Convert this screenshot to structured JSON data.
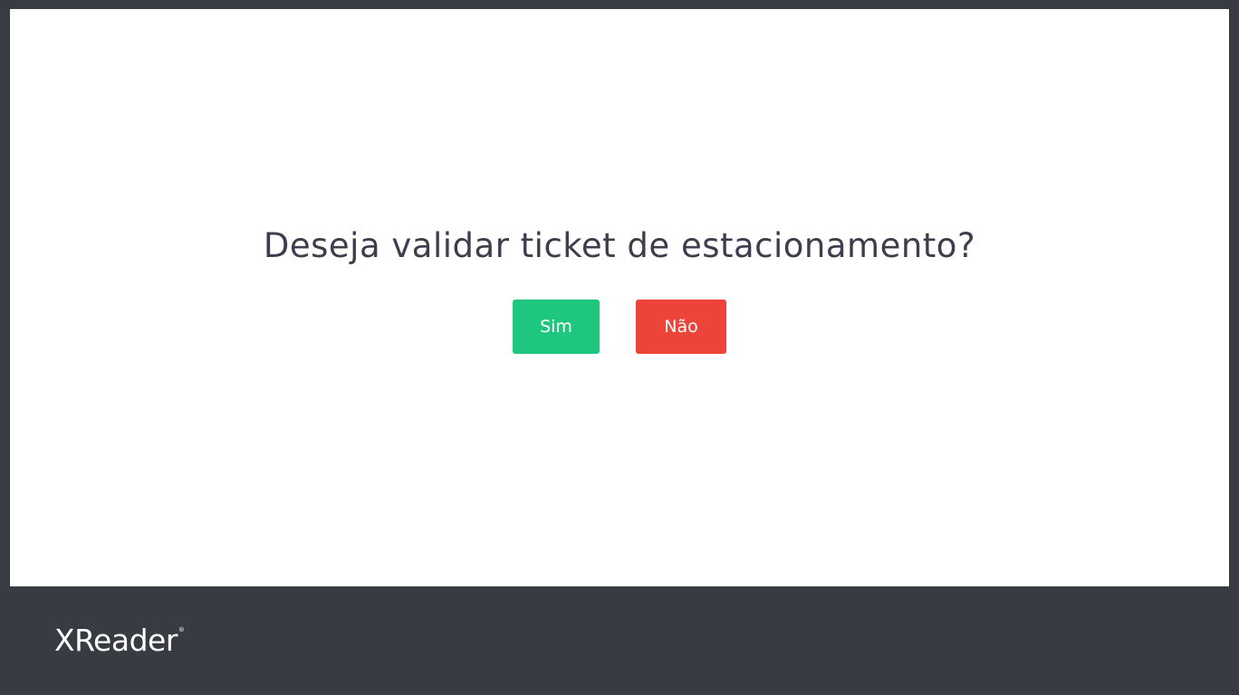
{
  "dialog": {
    "question": "Deseja validar ticket de estacionamento?",
    "yes_label": "Sim",
    "no_label": "Não",
    "yes_color": "#1fc77e",
    "no_color": "#ed443a"
  },
  "footer": {
    "brand": "XReader",
    "registered_mark": "®"
  }
}
